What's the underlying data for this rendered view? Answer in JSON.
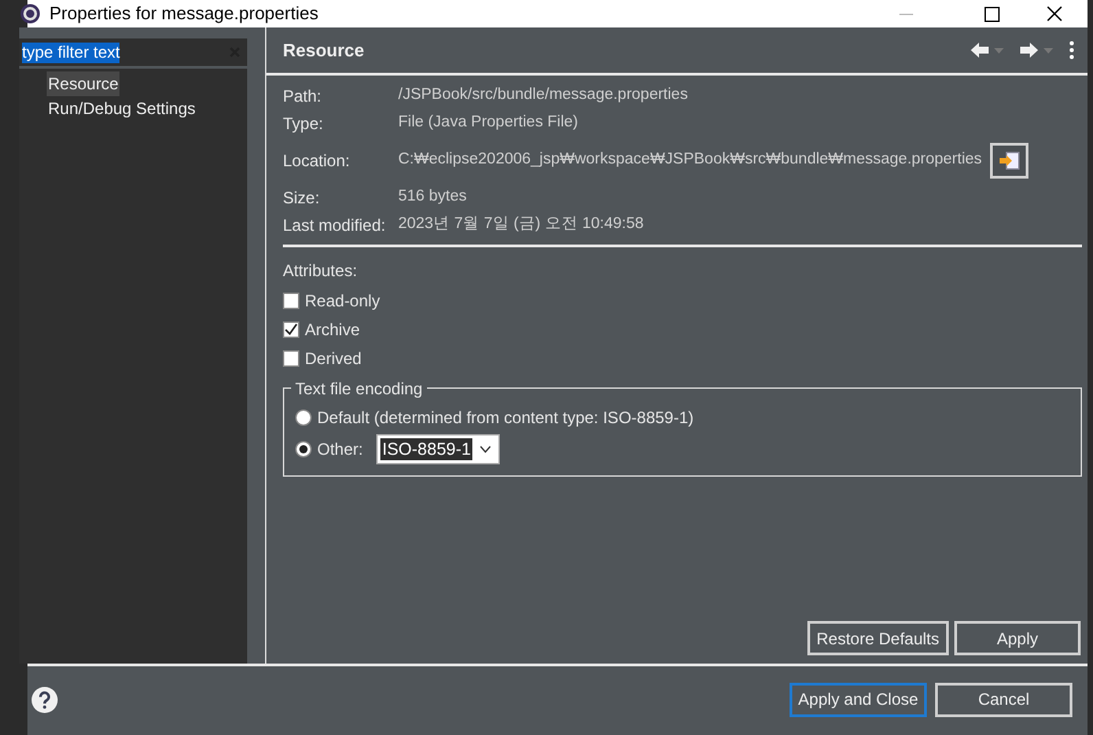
{
  "window": {
    "title": "Properties for message.properties"
  },
  "filter": {
    "value": "type filter text"
  },
  "tree": [
    {
      "label": "Resource",
      "selected": true
    },
    {
      "label": "Run/Debug Settings",
      "selected": false
    }
  ],
  "page": {
    "title": "Resource"
  },
  "info": [
    {
      "label": "Path:",
      "value": "/JSPBook/src/bundle/message.properties"
    },
    {
      "label": "Type:",
      "value": "File  (Java Properties File)"
    },
    {
      "label": "Location:",
      "value": "C:₩eclipse202006_jsp₩workspace₩JSPBook₩src₩bundle₩message.properties",
      "kind": "location"
    },
    {
      "label": "Size:",
      "value": "516  bytes"
    },
    {
      "label": "Last modified:",
      "value": "2023년 7월 7일 (금) 오전 10:49:58"
    }
  ],
  "attributes": {
    "label": "Attributes:",
    "items": [
      {
        "label": "Read-only",
        "checked": false
      },
      {
        "label": "Archive",
        "checked": true
      },
      {
        "label": "Derived",
        "checked": false
      }
    ]
  },
  "encoding": {
    "title": "Text file encoding",
    "options": [
      {
        "label": "Default (determined from content type: ISO-8859-1)",
        "selected": false
      },
      {
        "label": "Other:",
        "selected": true
      }
    ],
    "value": "ISO-8859-1"
  },
  "page_buttons": [
    "Restore Defaults",
    "Apply"
  ],
  "dialog_buttons": [
    {
      "label": "Apply and Close",
      "default": true
    },
    {
      "label": "Cancel",
      "default": false
    }
  ]
}
